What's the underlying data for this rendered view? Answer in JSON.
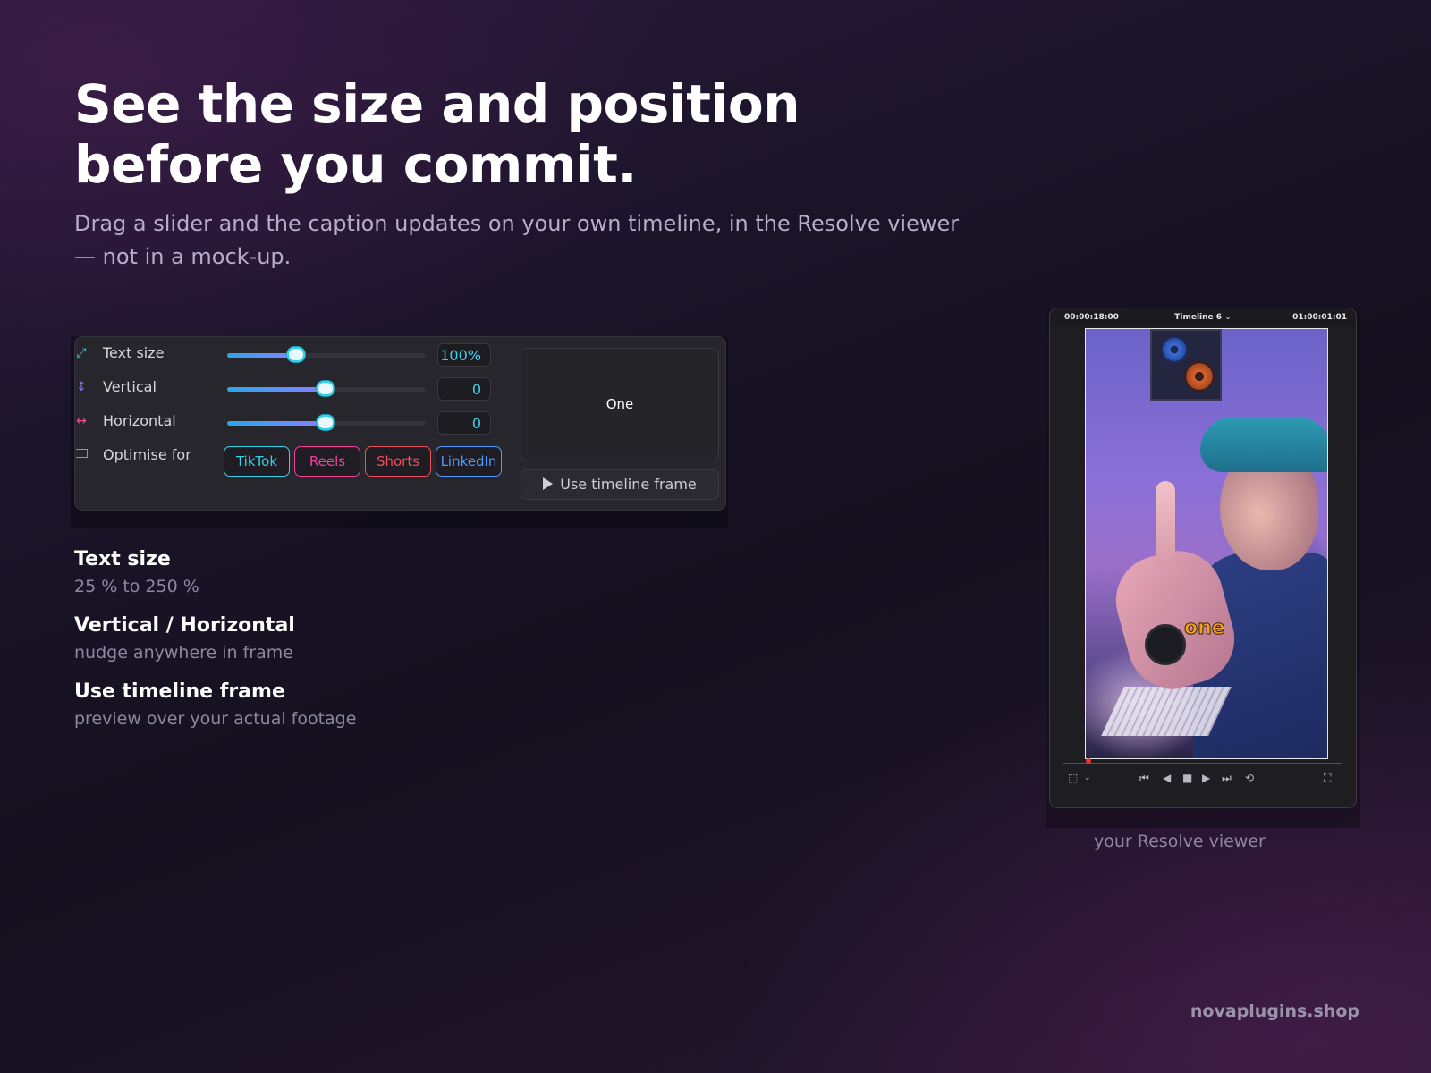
{
  "headline": {
    "line1": "See the size and position",
    "line2": "before you commit."
  },
  "subhead": {
    "line1": "Drag a slider and the caption updates on your own timeline, in the Resolve viewer",
    "line2": "— not in a mock-up."
  },
  "panel": {
    "rows": [
      {
        "label": "Text size",
        "icon": "resize-icon",
        "icon_color": "#2fd4e8",
        "value": "100%",
        "level": 0.35
      },
      {
        "label": "Vertical",
        "icon": "vertical-arrows-icon",
        "icon_color": "#8a6cf0",
        "value": "0",
        "level": 0.5
      },
      {
        "label": "Horizontal",
        "icon": "horizontal-arrows-icon",
        "icon_color": "#f04e8c",
        "value": "0",
        "level": 0.5
      }
    ],
    "optimise": {
      "label": "Optimise for",
      "icon_color": "#3fc77a",
      "chips": [
        {
          "label": "TikTok",
          "color": "#2fd4e8"
        },
        {
          "label": "Reels",
          "color": "#f0409a"
        },
        {
          "label": "Shorts",
          "color": "#f04e5a"
        },
        {
          "label": "LinkedIn",
          "color": "#4a9cff"
        }
      ]
    },
    "preview_text": "One",
    "timeline_button": "Use timeline frame"
  },
  "features": [
    {
      "title": "Text size",
      "desc": "25 % to 250 %"
    },
    {
      "title": "Vertical / Horizontal",
      "desc": "nudge anywhere in frame"
    },
    {
      "title": "Use timeline frame",
      "desc": "preview over your actual footage"
    }
  ],
  "viewer": {
    "timecode_left": "00:00:18:00",
    "timeline_name": "Timeline 6",
    "timecode_right": "01:00:01:01",
    "caption_word": "one",
    "caption_color": "#f2a21e",
    "label": "your Resolve viewer"
  },
  "brand": "novaplugins.shop",
  "colors": {
    "accent_cyan": "#2fd4e8",
    "subtext": "#8f86a1"
  }
}
